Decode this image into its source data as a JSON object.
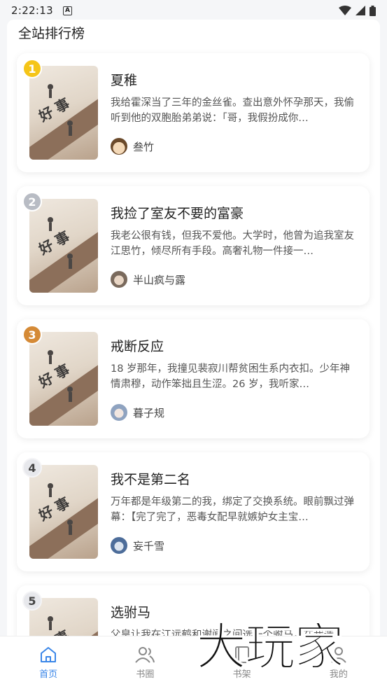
{
  "status": {
    "time": "2:22:13",
    "notif_icon": "A"
  },
  "section": {
    "title": "全站排行榜"
  },
  "books": [
    {
      "rank": "1",
      "title": "夏稚",
      "desc": "我给霍深当了三年的金丝雀。查出意外怀孕那天，我偷听到他的双胞胎弟弟说：「哥，我假扮成你…",
      "author": "叁竹"
    },
    {
      "rank": "2",
      "title": "我捡了室友不要的富豪",
      "desc": "我老公很有钱，但我不爱他。大学时，他曾为追我室友江思竹，倾尽所有手段。高奢礼物一件接一…",
      "author": "半山疯与露"
    },
    {
      "rank": "3",
      "title": "戒断反应",
      "desc": "18 岁那年，我撞见裴寂川帮贫困生系内衣扣。少年神情肃穆，动作笨拙且生涩。26 岁，我听家…",
      "author": "暮子规"
    },
    {
      "rank": "4",
      "title": "我不是第二名",
      "desc": "万年都是年级第二的我，绑定了交换系统。眼前飘过弹幕：【完了完了，恶毒女配早就嫉妒女主宝…",
      "author": "妄千雪"
    },
    {
      "rank": "5",
      "title": "选驸马",
      "desc": "父皇让我在江远鹤和谢闻之间选一个驸马，在我选…",
      "author": ""
    }
  ],
  "nav": [
    {
      "label": "首页",
      "icon": "home-icon"
    },
    {
      "label": "书圈",
      "icon": "people-icon"
    },
    {
      "label": "书架",
      "icon": "book-icon"
    },
    {
      "label": "我的",
      "icon": "person-icon"
    }
  ],
  "watermark": "大玩家"
}
